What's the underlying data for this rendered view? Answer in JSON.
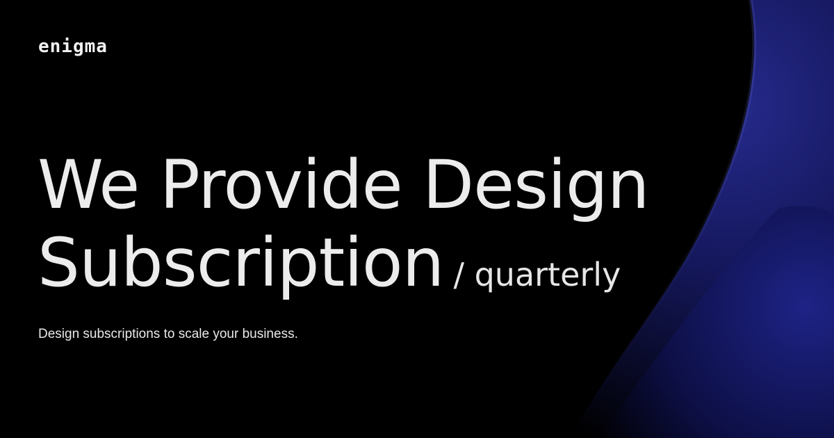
{
  "brand": {
    "logo_text": "enigma"
  },
  "hero": {
    "headline_line1": "We Provide Design",
    "headline_line2": "Subscription",
    "headline_suffix": "/ quarterly",
    "subtext": "Design subscriptions to scale your business."
  },
  "colors": {
    "background": "#000000",
    "text": "#ececec",
    "accent_blue": "#1c1f7a"
  }
}
